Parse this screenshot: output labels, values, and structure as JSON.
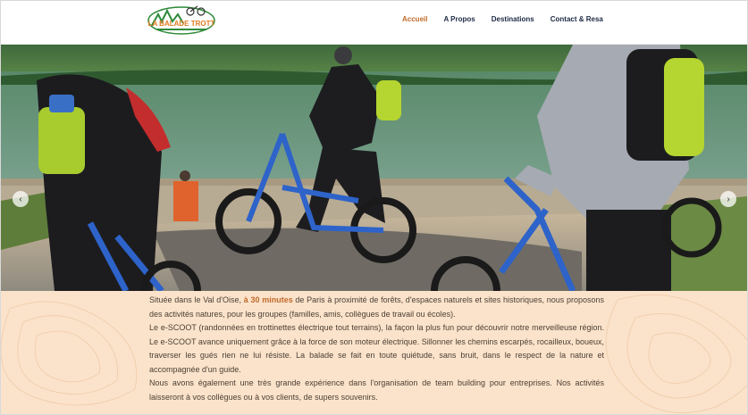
{
  "header": {
    "logo_text": "LA BALADE TROTT",
    "nav": [
      {
        "label": "Accueil",
        "active": true
      },
      {
        "label": "A Propos",
        "active": false
      },
      {
        "label": "Destinations",
        "active": false
      },
      {
        "label": "Contact & Resa",
        "active": false
      }
    ]
  },
  "hero": {
    "prev_icon": "chevron-left-icon",
    "next_icon": "chevron-right-icon",
    "prev_glyph": "‹",
    "next_glyph": "›"
  },
  "intro": {
    "p1_before": "Située dans le Val d'Oise, ",
    "p1_highlight": "à 30 minutes",
    "p1_after": " de Paris à proximité de forêts, d'espaces naturels et sites historiques, nous proposons des activités natures, pour les groupes (familles, amis, collègues de travail ou écoles).",
    "p2": "Le e-SCOOT (randonnées en trottinettes électrique tout terrains), la façon la plus fun pour découvrir notre merveilleuse région. Le e-SCOOT avance uniquement grâce à la force de son moteur électrique. Sillonner les chemins escarpés, rocailleux, boueux, traverser les gués rien ne lui résiste. La balade se fait en toute quiétude, sans bruit, dans le respect de la nature et accompagnée d'un guide.",
    "p3": "Nous avons également une très grande expérience dans l'organisation de team building pour entreprises. Nos activités laisseront à vos collègues ou à vos clients, de supers souvenirs."
  },
  "colors": {
    "accent": "#c06a2b",
    "nav": "#1d2a44",
    "content_bg": "#fbe3cb"
  }
}
